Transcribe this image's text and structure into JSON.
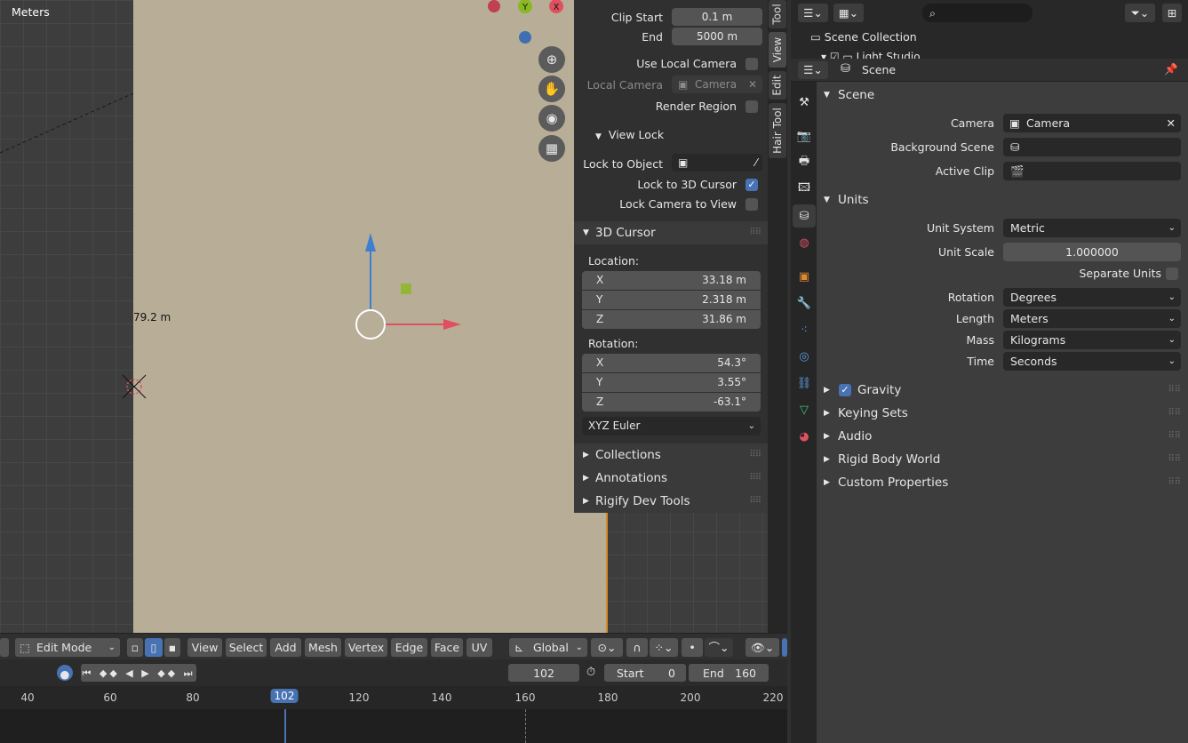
{
  "viewport": {
    "units_label": "Meters",
    "dimension_label": "79.2 m",
    "gizmo_y": "Y",
    "gizmo_x": "X"
  },
  "npanel": {
    "clip_start_label": "Clip Start",
    "clip_start_value": "0.1 m",
    "end_label": "End",
    "end_value": "5000 m",
    "use_local_camera_label": "Use Local Camera",
    "local_camera_label": "Local Camera",
    "local_camera_value": "Camera",
    "render_region_label": "Render Region",
    "view_lock_header": "View Lock",
    "lock_to_object_label": "Lock to Object",
    "lock_to_3d_cursor_label": "Lock to 3D Cursor",
    "lock_camera_to_view_label": "Lock Camera to View",
    "cursor_header": "3D Cursor",
    "location_label": "Location:",
    "location": [
      {
        "axis": "X",
        "value": "33.18 m"
      },
      {
        "axis": "Y",
        "value": "2.318 m"
      },
      {
        "axis": "Z",
        "value": "31.86 m"
      }
    ],
    "rotation_label": "Rotation:",
    "rotation": [
      {
        "axis": "X",
        "value": "54.3°"
      },
      {
        "axis": "Y",
        "value": "3.55°"
      },
      {
        "axis": "Z",
        "value": "-63.1°"
      }
    ],
    "rotation_mode": "XYZ Euler",
    "collapsed_sections": [
      "Collections",
      "Annotations",
      "Rigify Dev Tools"
    ]
  },
  "vtabs": [
    "Tool",
    "View",
    "Edit",
    "Hair Tool"
  ],
  "header": {
    "mode": "Edit Mode",
    "menus": [
      "View",
      "Select",
      "Add",
      "Mesh",
      "Vertex",
      "Edge",
      "Face",
      "UV"
    ],
    "orientation": "Global"
  },
  "timeline": {
    "current_frame": "102",
    "start_label": "Start",
    "start_value": "0",
    "end_label": "End",
    "end_value": "160",
    "ruler": [
      "40",
      "60",
      "80",
      "102",
      "120",
      "140",
      "160",
      "180",
      "200",
      "220"
    ]
  },
  "outliner": {
    "scene_collection": "Scene Collection",
    "child": "Light Studio"
  },
  "properties": {
    "context": "Scene",
    "scene_section": "Scene",
    "camera_label": "Camera",
    "camera_value": "Camera",
    "background_scene_label": "Background Scene",
    "active_clip_label": "Active Clip",
    "units_section": "Units",
    "unit_system_label": "Unit System",
    "unit_system_value": "Metric",
    "unit_scale_label": "Unit Scale",
    "unit_scale_value": "1.000000",
    "separate_units_label": "Separate Units",
    "rotation_label": "Rotation",
    "rotation_value": "Degrees",
    "length_label": "Length",
    "length_value": "Meters",
    "mass_label": "Mass",
    "mass_value": "Kilograms",
    "time_label": "Time",
    "time_value": "Seconds",
    "gravity_label": "Gravity",
    "collapsed": [
      "Keying Sets",
      "Audio",
      "Rigid Body World",
      "Custom Properties"
    ]
  },
  "colors": {
    "accent": "#4772b3",
    "camera_bg": "#b8ae98",
    "axis_x": "#e05060",
    "axis_y": "#8ab820",
    "axis_z": "#3f7fd0"
  }
}
